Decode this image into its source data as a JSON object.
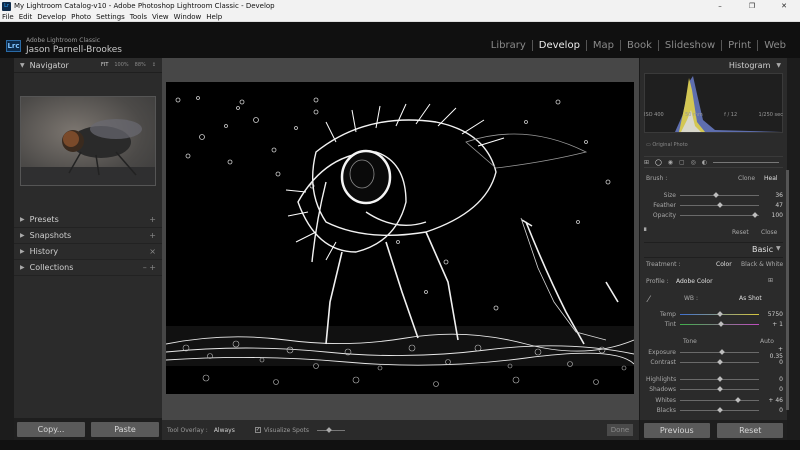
{
  "window": {
    "title": "My Lightroom Catalog-v10 - Adobe Photoshop Lightroom Classic - Develop",
    "app_icon": "Lr",
    "minimize": "–",
    "restore": "❐",
    "close": "✕"
  },
  "menu": [
    "File",
    "Edit",
    "Develop",
    "Photo",
    "Settings",
    "Tools",
    "View",
    "Window",
    "Help"
  ],
  "identity": {
    "badge": "Lrc",
    "product": "Adobe Lightroom Classic",
    "user": "Jason Parnell-Brookes"
  },
  "modules": [
    "Library",
    "Develop",
    "Map",
    "Book",
    "Slideshow",
    "Print",
    "Web"
  ],
  "active_module": "Develop",
  "navigator": {
    "title": "Navigator",
    "options": [
      "FIT",
      "100%",
      "88%",
      "↕"
    ]
  },
  "left_sections": [
    {
      "title": "Presets",
      "action": "+"
    },
    {
      "title": "Snapshots",
      "action": "+"
    },
    {
      "title": "History",
      "action": "×"
    },
    {
      "title": "Collections",
      "action": "–  +"
    }
  ],
  "left_buttons": {
    "copy": "Copy...",
    "paste": "Paste"
  },
  "toolbar": {
    "overlay_label": "Tool Overlay :",
    "overlay_value": "Always",
    "visualize_label": "Visualize Spots",
    "visualize_checked": "✓",
    "done": "Done"
  },
  "histogram": {
    "title": "Histogram",
    "iso": "ISO 400",
    "focal": "50 mm",
    "aperture": "f / 12",
    "shutter": "1/250 sec",
    "original": "Original Photo"
  },
  "brush": {
    "label": "Brush :",
    "mode_clone": "Clone",
    "mode_heal": "Heal",
    "sliders": [
      {
        "label": "Size",
        "value": "36",
        "pos": 0.45
      },
      {
        "label": "Feather",
        "value": "47",
        "pos": 0.5
      },
      {
        "label": "Opacity",
        "value": "100",
        "pos": 0.95
      }
    ],
    "reset": "Reset",
    "close": "Close"
  },
  "basic": {
    "title": "Basic",
    "treatment_label": "Treatment :",
    "treatment_color": "Color",
    "treatment_bw": "Black & White",
    "profile_label": "Profile :",
    "profile_value": "Adobe Color",
    "wb_label": "WB :",
    "wb_value": "As Shot",
    "temp": {
      "label": "Temp",
      "value": "5750",
      "pos": 0.5
    },
    "tint": {
      "label": "Tint",
      "value": "+ 1",
      "pos": 0.52
    },
    "tone_label": "Tone",
    "tone_auto": "Auto",
    "tone_sliders": [
      {
        "label": "Exposure",
        "value": "+ 0.35",
        "pos": 0.53
      },
      {
        "label": "Contrast",
        "value": "0",
        "pos": 0.5
      }
    ],
    "presence_sliders": [
      {
        "label": "Highlights",
        "value": "0",
        "pos": 0.5
      },
      {
        "label": "Shadows",
        "value": "0",
        "pos": 0.5
      },
      {
        "label": "Whites",
        "value": "+ 46",
        "pos": 0.73
      },
      {
        "label": "Blacks",
        "value": "0",
        "pos": 0.5
      }
    ]
  },
  "right_buttons": {
    "previous": "Previous",
    "reset": "Reset"
  }
}
